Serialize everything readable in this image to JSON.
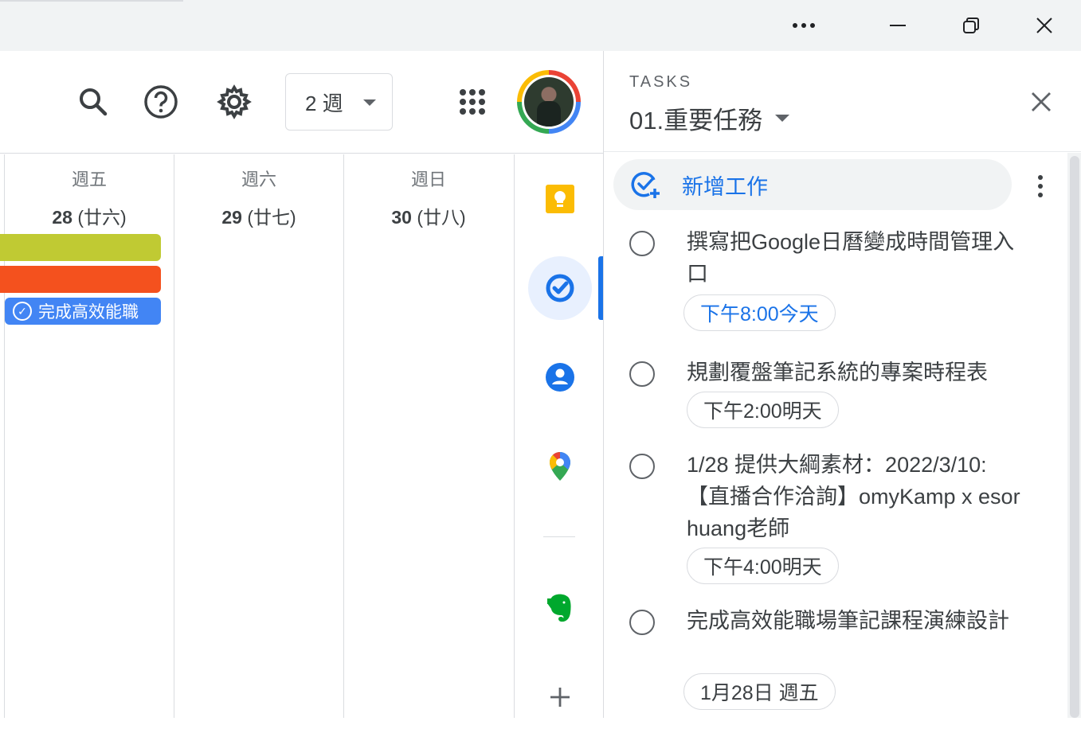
{
  "window": {
    "more_icon": "more-horizontal-icon",
    "minimize_icon": "minimize-icon",
    "restore_icon": "restore-icon",
    "close_icon": "close-icon"
  },
  "toolbar": {
    "search_icon": "search-icon",
    "help_icon": "help-icon",
    "settings_icon": "gear-icon",
    "view_select": "2 週",
    "apps_icon": "apps-grid-icon"
  },
  "calendar": {
    "days": [
      {
        "name": "週五",
        "num": "28",
        "lunar": "(廿六)"
      },
      {
        "name": "週六",
        "num": "29",
        "lunar": "(廿七)"
      },
      {
        "name": "週日",
        "num": "30",
        "lunar": "(廿八)"
      }
    ],
    "events": [
      {
        "color": "#c0ca33"
      },
      {
        "color": "#f4511e"
      }
    ],
    "task_event": {
      "label": "完成高效能職",
      "color": "#4285f4"
    }
  },
  "side_rail": {
    "items": [
      "keep-icon",
      "tasks-icon",
      "contacts-icon",
      "maps-icon",
      "evernote-icon",
      "add-icon"
    ]
  },
  "tasks_panel": {
    "header_label": "TASKS",
    "list_name": "01.重要任務",
    "add_task_label": "新增工作",
    "tasks": [
      {
        "title": "撰寫把Google日曆變成時間管理入口",
        "due": "下午8:00今天",
        "due_style": "today"
      },
      {
        "title": "規劃覆盤筆記系統的專案時程表",
        "due": "下午2:00明天",
        "due_style": "later"
      },
      {
        "title": "1/28 提供大綱素材：2022/3/10:【直播合作洽詢】omyKamp x esor huang老師",
        "due": "下午4:00明天",
        "due_style": "later"
      },
      {
        "title": "完成高效能職場筆記課程演練設計",
        "due": "1月28日 週五",
        "due_style": "later"
      }
    ]
  }
}
